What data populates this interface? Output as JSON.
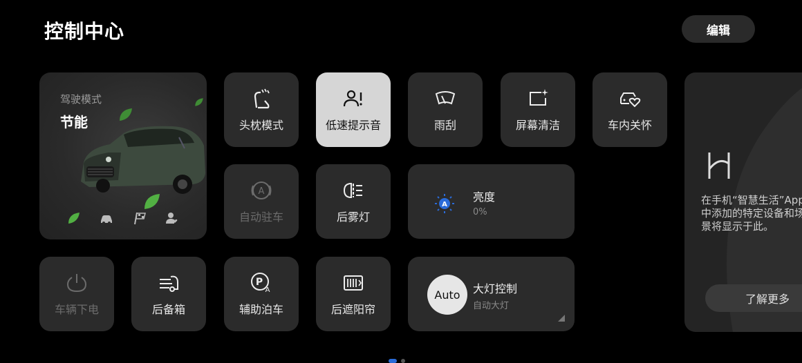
{
  "header": {
    "title": "控制中心",
    "edit_label": "编辑"
  },
  "drive_mode": {
    "label": "驾驶模式",
    "value": "节能",
    "mode_icons": [
      "leaf-icon",
      "car-icon",
      "race-flag-icon",
      "person-heart-icon"
    ]
  },
  "tiles": {
    "headrest": "头枕模式",
    "low_speed_alert": "低速提示音",
    "wiper": "雨刮",
    "screen_clean": "屏幕清洁",
    "cabin_care": "车内关怀",
    "auto_hold": "自动驻车",
    "rear_fog": "后雾灯",
    "power_off": "车辆下电",
    "trunk": "后备箱",
    "park_assist": "辅助泊车",
    "rear_shade": "后遮阳帘"
  },
  "brightness": {
    "label": "亮度",
    "value": "0%"
  },
  "headlight": {
    "label": "大灯控制",
    "status": "自动大灯",
    "badge": "Auto"
  },
  "side_panel": {
    "message": "在手机“智慧生活”App中添加的特定设备和场景将显示于此。",
    "learn_more": "了解更多"
  },
  "colors": {
    "accent": "#2a6bd8",
    "active_tile": "#d6d6d6",
    "tile": "#2b2b2b",
    "eco_green": "#52b043"
  }
}
